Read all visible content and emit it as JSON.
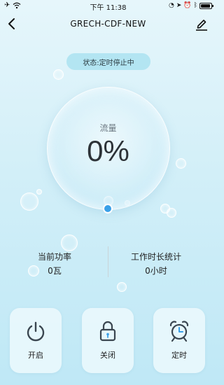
{
  "status_bar": {
    "time": "下午 11:38"
  },
  "header": {
    "title": "GRECH-CDF-NEW"
  },
  "status": {
    "text": "状态:定时停止中"
  },
  "flow": {
    "label": "流量",
    "value": "0%"
  },
  "stats": {
    "power": {
      "label": "当前功率",
      "value": "0瓦"
    },
    "work_time": {
      "label": "工作时长统计",
      "value": "0小时"
    }
  },
  "controls": {
    "on": {
      "label": "开启",
      "icon": "power-icon"
    },
    "off": {
      "label": "关闭",
      "icon": "lock-icon"
    },
    "timer": {
      "label": "定时",
      "icon": "alarm-clock-icon"
    }
  },
  "colors": {
    "accent": "#3aa0e8",
    "pill": "#b3e5f2"
  }
}
